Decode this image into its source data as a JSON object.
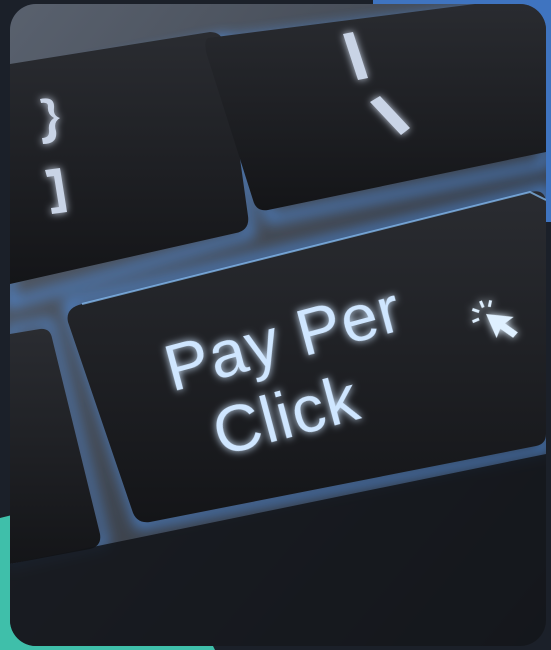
{
  "image": {
    "subject": "keyboard-key",
    "key_text_line1": "Pay Per",
    "key_text_line2": "Click",
    "colors": {
      "background": "#1b2029",
      "accent_blue": "#3f74c0",
      "accent_teal": "#3fbfaa",
      "key_glow": "#6fb7ff",
      "key_surface": "#1c1d21"
    },
    "icons": [
      "cursor-click-icon"
    ]
  }
}
